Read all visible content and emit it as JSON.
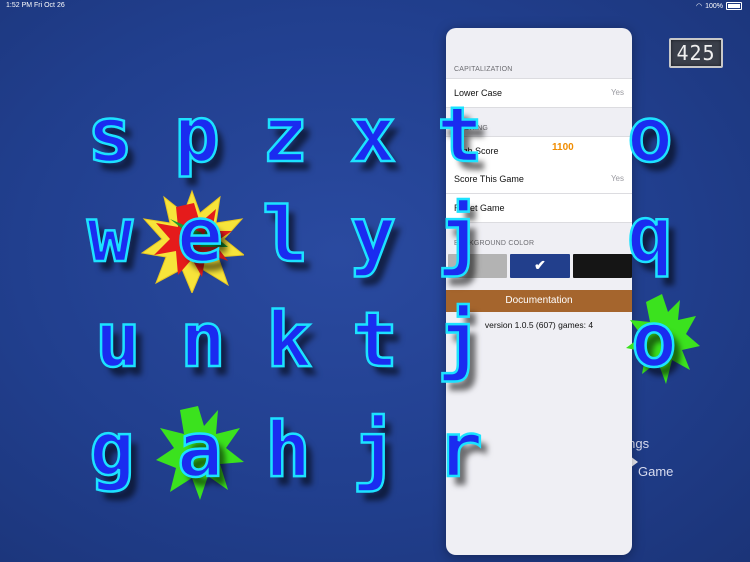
{
  "status_bar": {
    "time": "1:52 PM",
    "date": "Fri Oct 26",
    "battery": "100%"
  },
  "score_display": "425",
  "letters": [
    [
      "s",
      "p",
      "z",
      "x",
      "t",
      "o"
    ],
    [
      "w",
      "e",
      "l",
      "y",
      "j",
      "q"
    ],
    [
      "u",
      "n",
      "k",
      "t",
      "j",
      "o"
    ],
    [
      "g",
      "a",
      "h",
      "j",
      "r"
    ]
  ],
  "background_menu": {
    "settings": "Settings",
    "game": "Game",
    "settings_visible": "ttings"
  },
  "settings": {
    "capitalization": {
      "header": "CAPITALIZATION",
      "lower_case_label": "Lower Case",
      "lower_case_value": "Yes"
    },
    "scoring": {
      "header": "SCORING",
      "high_score_label": "High Score",
      "high_score_value": "1100",
      "score_this_game_label": "Score This Game",
      "score_this_game_value": "Yes",
      "reset_game_label": "Reset Game"
    },
    "background_color": {
      "header": "BACKGROUND COLOR",
      "swatches": [
        "#b3b3b3",
        "#223f8c",
        "#151515"
      ],
      "selected_mark": "✔"
    },
    "documentation_label": "Documentation",
    "version_text": "version 1.0.5 (607) games: 4"
  },
  "colors": {
    "letter_fill": "#1a2cf0",
    "letter_outline": "#1ce2ff",
    "accent_orange": "#f08c00"
  }
}
